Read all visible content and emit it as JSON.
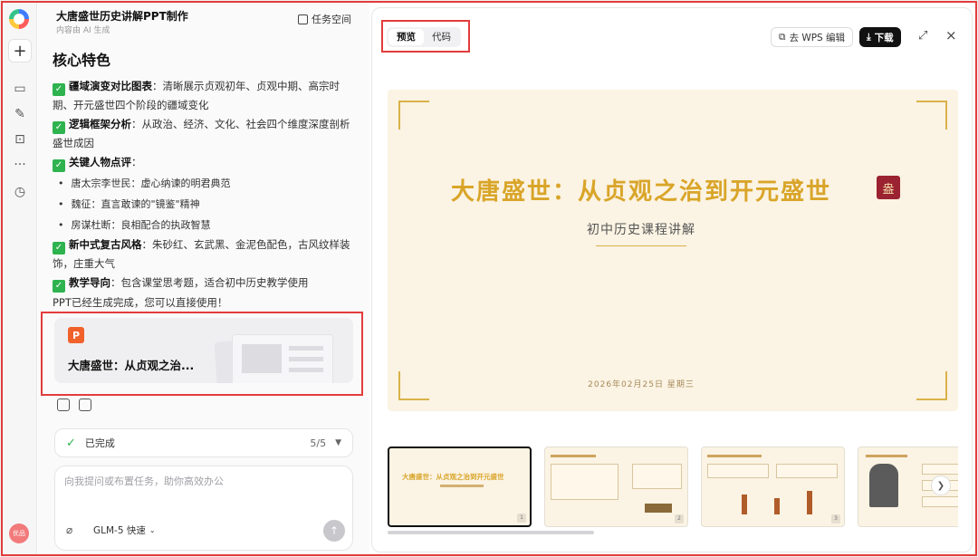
{
  "chat": {
    "title": "大唐盛世历史讲解PPT制作",
    "subtitle": "内容由 AI 生成",
    "task_space": "任务空间",
    "heading": "核心特色",
    "features": [
      {
        "bold": "疆域演变对比图表",
        "text": "：清晰展示贞观初年、贞观中期、高宗时期、开元盛世四个阶段的疆域变化"
      },
      {
        "bold": "逻辑框架分析",
        "text": "：从政治、经济、文化、社会四个维度深度剖析盛世成因"
      },
      {
        "bold": "关键人物点评",
        "text": "："
      }
    ],
    "bullets": [
      "唐太宗李世民：虚心纳谏的明君典范",
      "魏征：直言敢谏的\"镜鉴\"精神",
      "房谋杜断：良相配合的执政智慧"
    ],
    "features2": [
      {
        "bold": "新中式复古风格",
        "text": "：朱砂红、玄武黑、金泥色配色，古风纹样装饰，庄重大气"
      },
      {
        "bold": "教学导向",
        "text": "：包含课堂思考题，适合初中历史教学使用"
      }
    ],
    "done_text": "PPT已经生成完成，您可以直接使用！",
    "card_title": "大唐盛世：从贞观之治...",
    "status_label": "已完成",
    "status_count": "5/5",
    "input_placeholder": "向我提问或布置任务，助你高效办公",
    "model_label": "GLM-5 快速",
    "avatar_text": "优品"
  },
  "preview": {
    "tabs": [
      "预览",
      "代码"
    ],
    "wps_label": "去 WPS 编辑",
    "download_label": "下载",
    "slide": {
      "title": "大唐盛世：从贞观之治到开元盛世",
      "subtitle": "初中历史课程讲解",
      "date": "2026年02月25日 星期三",
      "seal_text": "盎"
    },
    "thumbs": [
      {
        "title": "大唐盛世：从贞观之治到开元盛世",
        "num": "1"
      },
      {
        "title": "",
        "num": "2"
      },
      {
        "title": "",
        "num": "3"
      },
      {
        "title": "",
        "num": "4"
      }
    ]
  },
  "colors": {
    "accent_red": "#e23c3c",
    "gold": "#d9a529",
    "slide_bg": "#fbf3e3",
    "check_green": "#2eb34f"
  }
}
